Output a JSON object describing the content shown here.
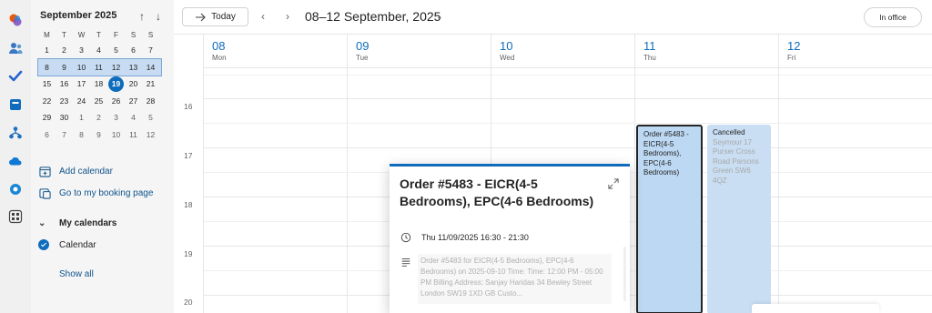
{
  "mini_calendar": {
    "title": "September 2025",
    "days_of_week": [
      "M",
      "T",
      "W",
      "T",
      "F",
      "S",
      "S"
    ],
    "weeks": [
      [
        "1",
        "2",
        "3",
        "4",
        "5",
        "6",
        "7"
      ],
      [
        "8",
        "9",
        "10",
        "11",
        "12",
        "13",
        "14"
      ],
      [
        "15",
        "16",
        "17",
        "18",
        "19",
        "20",
        "21"
      ],
      [
        "22",
        "23",
        "24",
        "25",
        "26",
        "27",
        "28"
      ],
      [
        "29",
        "30",
        "1",
        "2",
        "3",
        "4",
        "5"
      ],
      [
        "6",
        "7",
        "8",
        "9",
        "10",
        "11",
        "12"
      ]
    ],
    "selected_week": 1,
    "today": "19"
  },
  "sidebar": {
    "add_calendar": "Add calendar",
    "booking_page": "Go to my booking page",
    "my_calendars": "My calendars",
    "calendar": "Calendar",
    "show_all": "Show all"
  },
  "toolbar": {
    "today": "Today",
    "date_range": "08–12 September, 2025",
    "in_office": "In office"
  },
  "days": [
    {
      "num": "08",
      "name": "Mon"
    },
    {
      "num": "09",
      "name": "Tue"
    },
    {
      "num": "10",
      "name": "Wed"
    },
    {
      "num": "11",
      "name": "Thu"
    },
    {
      "num": "12",
      "name": "Fri"
    }
  ],
  "hours": [
    "16",
    "17",
    "18",
    "19",
    "20"
  ],
  "events": {
    "order": "Order #5483 - EICR(4-5 Bedrooms), EPC(4-6 Bedrooms)",
    "cancelled_title": "Cancelled",
    "cancelled_detail": "Seymour 17 Purser Cross Road Parsons Green SW6 4QZ"
  },
  "popup": {
    "title": "Order #5483 - EICR(4-5 Bedrooms), EPC(4-6 Bedrooms)",
    "time": "Thu 11/09/2025 16:30 - 21:30",
    "description": "Order #5483 for EICR(4-5 Bedrooms), EPC(4-6 Bedrooms) on 2025-09-10 Time: Time: 12:00 PM - 05:00 PM Billing Address: Sanjay Haridas 34 Bewley Street London SW19 1XD GB Custo..."
  },
  "colors": {
    "accent": "#0f6cbd",
    "event_fill": "#bdd8f2",
    "sidebar_bg": "#f5f5f5"
  }
}
